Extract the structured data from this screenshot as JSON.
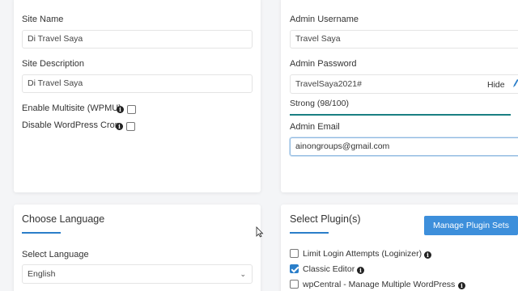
{
  "site": {
    "name_label": "Site Name",
    "name_value": "Di Travel Saya",
    "desc_label": "Site Description",
    "desc_value": "Di Travel Saya",
    "multisite_label": "Enable Multisite (WPMU)",
    "cron_label": "Disable WordPress Cron"
  },
  "admin": {
    "username_label": "Admin Username",
    "username_value": "Travel Saya",
    "password_label": "Admin Password",
    "password_value": "TravelSaya2021#",
    "hide_label": "Hide",
    "strength_label": "Strong (98/100)",
    "email_label": "Admin Email",
    "email_value": "ainongroups@gmail.com"
  },
  "language": {
    "title": "Choose Language",
    "select_label": "Select Language",
    "selected": "English"
  },
  "plugins": {
    "title": "Select Plugin(s)",
    "manage_button": "Manage Plugin Sets",
    "items": [
      {
        "label": "Limit Login Attempts (Loginizer)",
        "checked": false
      },
      {
        "label": "Classic Editor",
        "checked": true
      },
      {
        "label": "wpCentral - Manage Multiple WordPress",
        "checked": false
      }
    ]
  },
  "colors": {
    "accent": "#2a7ec9",
    "strength_bar": "#1a7f82"
  },
  "password_strength": 0.98
}
